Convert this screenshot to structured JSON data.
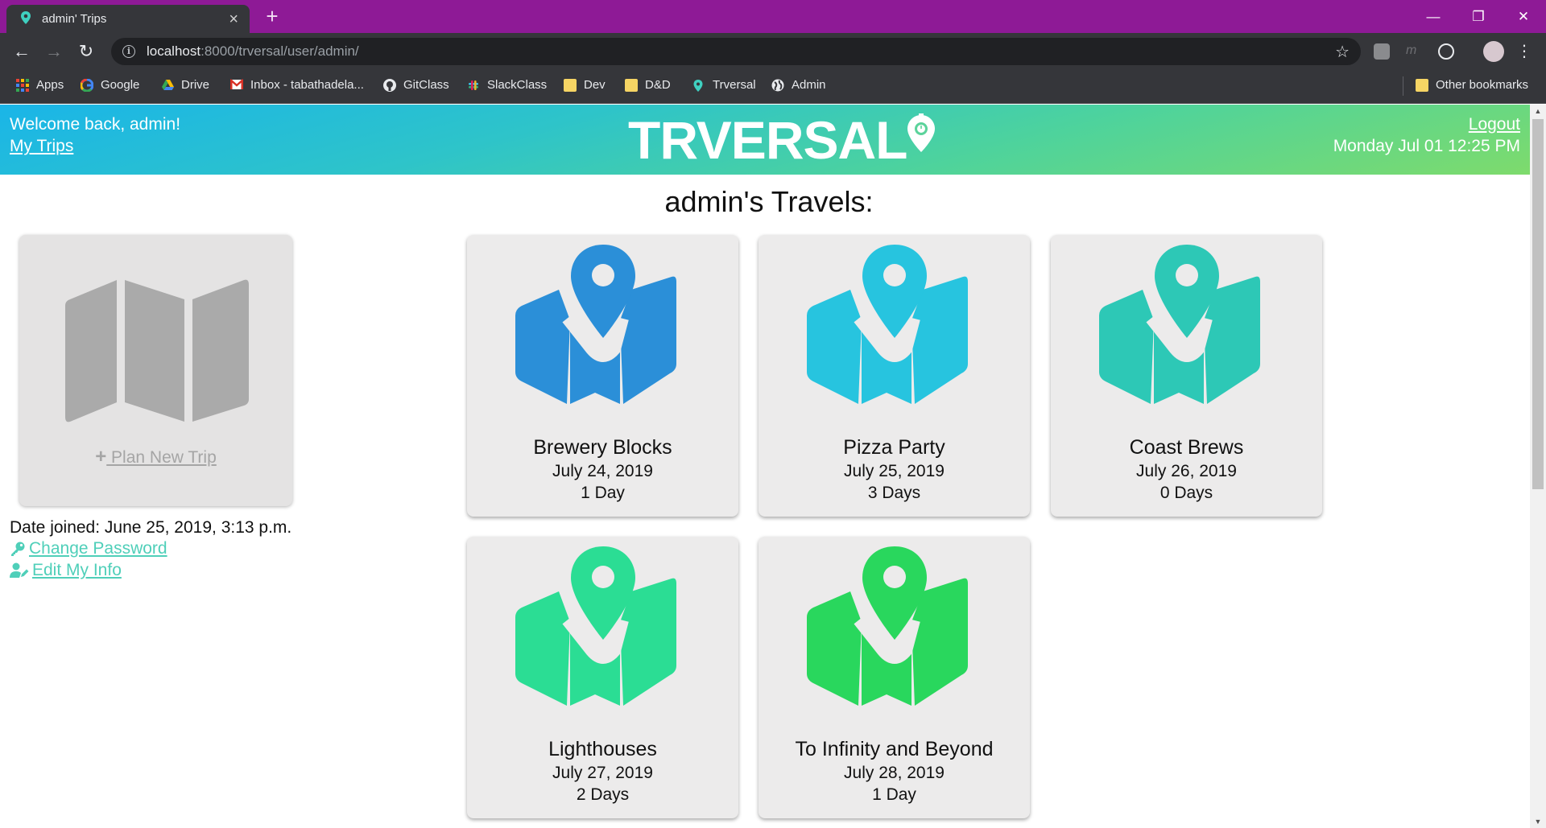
{
  "browser": {
    "tab_title": "admin' Trips",
    "new_tab_symbol": "+",
    "url_host": "localhost",
    "url_path": ":8000/trversal/user/admin/",
    "bookmarks": [
      {
        "label": "Apps",
        "icon": "apps-grid-icon"
      },
      {
        "label": "Google",
        "icon": "google-icon"
      },
      {
        "label": "Drive",
        "icon": "drive-icon"
      },
      {
        "label": "Inbox - tabathadela...",
        "icon": "gmail-icon"
      },
      {
        "label": "GitClass",
        "icon": "github-icon"
      },
      {
        "label": "SlackClass",
        "icon": "slack-icon"
      },
      {
        "label": "Dev",
        "icon": "folder-icon"
      },
      {
        "label": "D&D",
        "icon": "folder-icon"
      },
      {
        "label": "Trversal",
        "icon": "map-pin-icon"
      },
      {
        "label": "Admin",
        "icon": "globe-icon"
      }
    ],
    "other_bookmarks": "Other bookmarks"
  },
  "header": {
    "welcome": "Welcome back, admin!",
    "my_trips": "My Trips",
    "brand": "TRVERSAL",
    "logout": "Logout",
    "datetime": "Monday Jul 01 12:25 PM"
  },
  "heading": "admin's Travels:",
  "plan_card": {
    "label": " Plan New Trip",
    "plus": "+"
  },
  "profile": {
    "date_joined": "Date joined: June 25, 2019, 3:13 p.m.",
    "change_password": " Change Password",
    "edit_info": " Edit My Info"
  },
  "trips": [
    {
      "name": "Brewery Blocks",
      "date": "July 24, 2019",
      "length": "1 Day",
      "color": "#2b8fd8"
    },
    {
      "name": "Pizza Party",
      "date": "July 25, 2019",
      "length": "3 Days",
      "color": "#27c4df"
    },
    {
      "name": "Coast Brews",
      "date": "July 26, 2019",
      "length": "0 Days",
      "color": "#2dc8b6"
    },
    {
      "name": "Lighthouses",
      "date": "July 27, 2019",
      "length": "2 Days",
      "color": "#2bdd94"
    },
    {
      "name": "To Infinity and Beyond",
      "date": "July 28, 2019",
      "length": "1 Day",
      "color": "#29d75d"
    }
  ],
  "colors": {
    "chrome_frame": "#8e1a96",
    "link_teal": "#4fcfb9",
    "plan_gray": "#a5a5a5"
  }
}
